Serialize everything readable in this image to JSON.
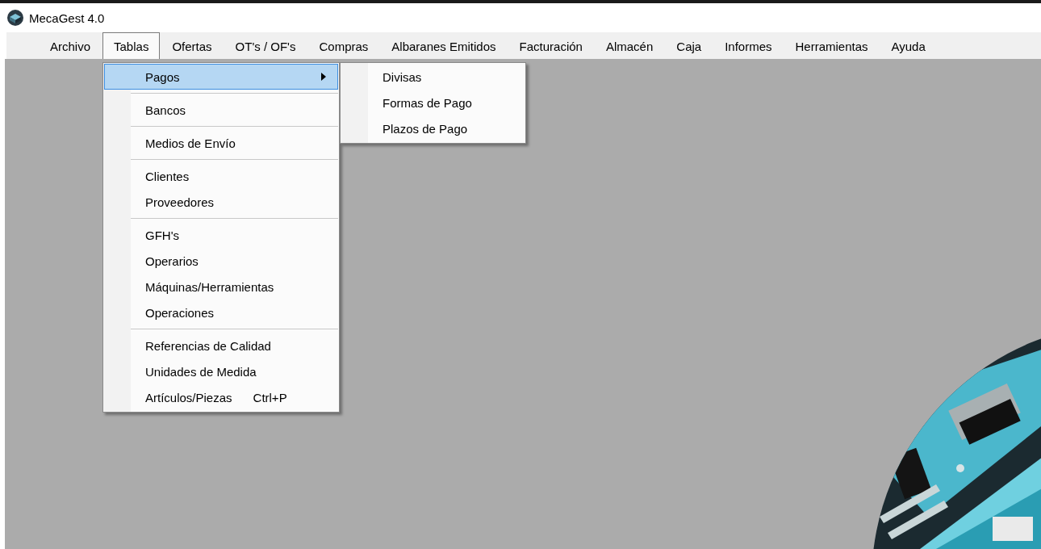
{
  "window": {
    "title": "MecaGest 4.0"
  },
  "menu_bar": [
    {
      "label": "Archivo",
      "selected": false
    },
    {
      "label": "Tablas",
      "selected": true
    },
    {
      "label": "Ofertas",
      "selected": false
    },
    {
      "label": "OT's / OF's",
      "selected": false
    },
    {
      "label": "Compras",
      "selected": false
    },
    {
      "label": "Albaranes Emitidos",
      "selected": false
    },
    {
      "label": "Facturación",
      "selected": false
    },
    {
      "label": "Almacén",
      "selected": false
    },
    {
      "label": "Caja",
      "selected": false
    },
    {
      "label": "Informes",
      "selected": false
    },
    {
      "label": "Herramientas",
      "selected": false
    },
    {
      "label": "Ayuda",
      "selected": false
    }
  ],
  "dropdown": {
    "groups": [
      [
        {
          "label": "Pagos",
          "selected": true,
          "has_submenu": true
        }
      ],
      [
        {
          "label": "Bancos",
          "selected": false,
          "has_submenu": false
        }
      ],
      [
        {
          "label": "Medios de Envío",
          "selected": false,
          "has_submenu": false
        }
      ],
      [
        {
          "label": "Clientes",
          "selected": false,
          "has_submenu": false
        },
        {
          "label": "Proveedores",
          "selected": false,
          "has_submenu": false
        }
      ],
      [
        {
          "label": "GFH's",
          "selected": false,
          "has_submenu": false
        },
        {
          "label": "Operarios",
          "selected": false,
          "has_submenu": false
        },
        {
          "label": "Máquinas/Herramientas",
          "selected": false,
          "has_submenu": false
        },
        {
          "label": "Operaciones",
          "selected": false,
          "has_submenu": false
        }
      ],
      [
        {
          "label": "Referencias de Calidad",
          "selected": false,
          "has_submenu": false
        },
        {
          "label": "Unidades de Medida",
          "selected": false,
          "has_submenu": false
        },
        {
          "label": "Artículos/Piezas",
          "shortcut": "Ctrl+P",
          "selected": false,
          "has_submenu": false
        }
      ]
    ]
  },
  "submenu": {
    "items": [
      {
        "label": "Divisas",
        "selected": false
      },
      {
        "label": "Formas de Pago",
        "selected": false
      },
      {
        "label": "Plazos de Pago",
        "selected": false
      }
    ]
  }
}
